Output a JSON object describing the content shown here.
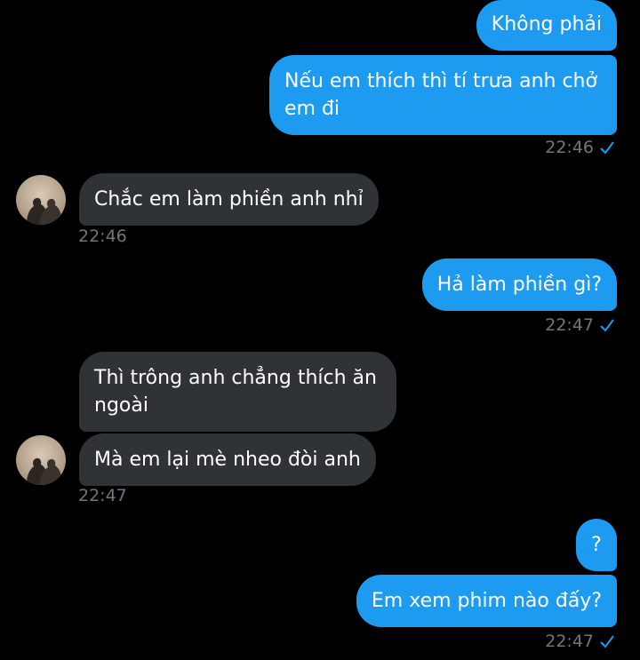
{
  "colors": {
    "background": "#000000",
    "outgoing_bubble": "#1d9bf0",
    "incoming_bubble": "#2f3336",
    "timestamp": "#71767b",
    "read_check": "#1d9bf0"
  },
  "messages": [
    {
      "direction": "outgoing",
      "text": "Không phải"
    },
    {
      "direction": "outgoing",
      "text": "Nếu em thích thì tí trưa anh chở em đi"
    },
    {
      "direction": "outgoing_meta",
      "time": "22:46",
      "status_icon": "check-icon"
    },
    {
      "direction": "incoming",
      "text": "Chắc em làm phiền anh nhỉ"
    },
    {
      "direction": "incoming_meta",
      "time": "22:46"
    },
    {
      "direction": "outgoing",
      "text": "Hả làm phiền gì?"
    },
    {
      "direction": "outgoing_meta",
      "time": "22:47",
      "status_icon": "check-icon"
    },
    {
      "direction": "incoming",
      "text": "Thì trông anh chẳng thích ăn ngoài"
    },
    {
      "direction": "incoming",
      "text": "Mà em lại mè nheo đòi anh"
    },
    {
      "direction": "incoming_meta",
      "time": "22:47"
    },
    {
      "direction": "outgoing",
      "text": "?"
    },
    {
      "direction": "outgoing",
      "text": "Em xem phim nào đấy?"
    },
    {
      "direction": "outgoing_meta",
      "time": "22:47",
      "status_icon": "check-icon"
    }
  ]
}
